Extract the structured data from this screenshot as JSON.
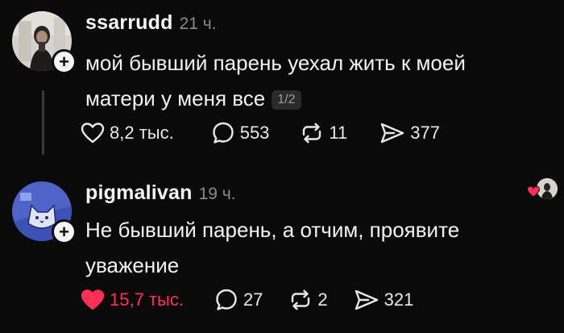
{
  "posts": [
    {
      "username": "ssarrudd",
      "time": "21 ч.",
      "text": "мой бывший парень уехал жить к моей матери у меня все",
      "pager": "1/2",
      "likes": "8,2 тыс.",
      "replies": "553",
      "reposts": "11",
      "shares": "377",
      "liked": false
    },
    {
      "username": "pigmalivan",
      "time": "19 ч.",
      "text": "Не бывший парень, а отчим, проявите уважение",
      "likes": "15,7 тыс.",
      "replies": "27",
      "reposts": "2",
      "shares": "321",
      "liked": true
    }
  ],
  "colors": {
    "background": "#0a0a0a",
    "text": "#f3f3f3",
    "muted": "#8a8a8a",
    "liked": "#ff2f55",
    "badge": "#f4f4f4"
  },
  "icons": {
    "follow": "plus-icon",
    "like": "heart-icon",
    "reply": "comment-bubble-icon",
    "repost": "repost-arrows-icon",
    "share": "send-paper-plane-icon"
  }
}
